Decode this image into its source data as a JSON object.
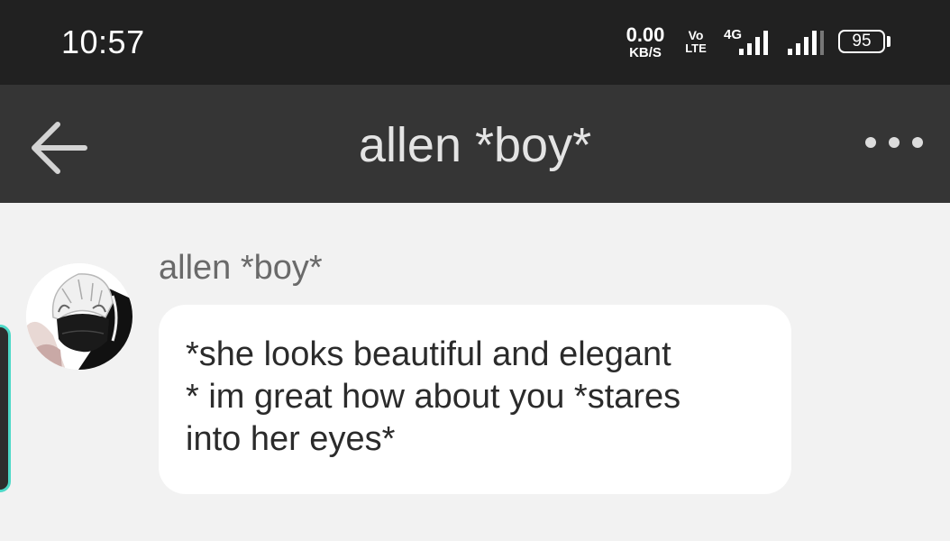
{
  "status_bar": {
    "time": "10:57",
    "net_speed_value": "0.00",
    "net_speed_unit": "KB/S",
    "volte_top": "Vo",
    "volte_bottom": "LTE",
    "network_type": "4G",
    "battery_level": "95"
  },
  "header": {
    "title": "allen *boy*",
    "back_icon": "arrow-left-icon",
    "menu_icon": "more-horizontal-icon"
  },
  "message": {
    "sender": "allen *boy*",
    "text": "*she looks beautiful and elegant\n* im great how about you *stares\ninto her eyes*"
  },
  "colors": {
    "status_bar_bg": "#212121",
    "app_bar_bg": "#353535",
    "chat_bg": "#f2f2f2",
    "bubble_bg": "#ffffff",
    "accent": "#4dd9c8"
  }
}
